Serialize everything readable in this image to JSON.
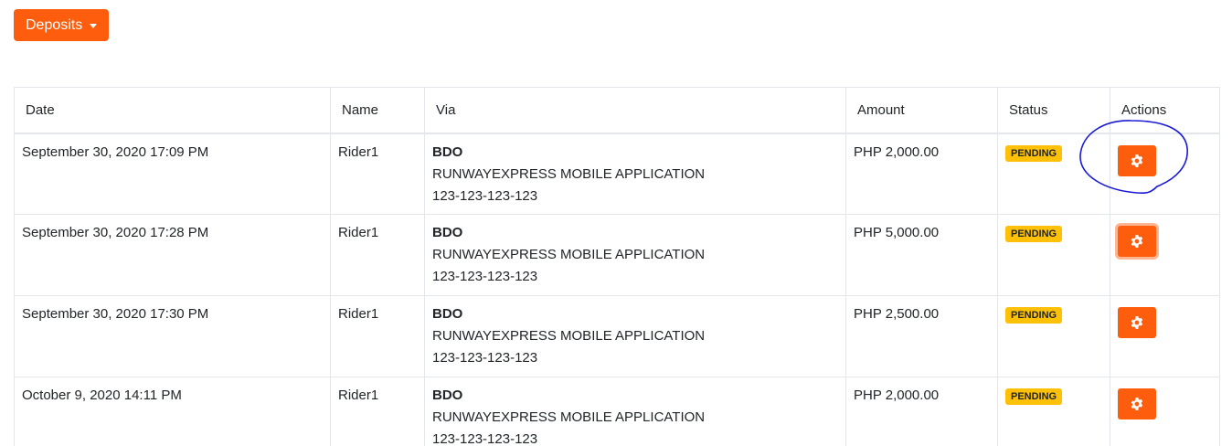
{
  "toolbar": {
    "dropdown_label": "Deposits"
  },
  "table": {
    "headers": {
      "date": "Date",
      "name": "Name",
      "via": "Via",
      "amount": "Amount",
      "status": "Status",
      "actions": "Actions"
    },
    "rows": [
      {
        "date": "September 30, 2020 17:09 PM",
        "name": "Rider1",
        "via_bank": "BDO",
        "via_account": "RUNWAYEXPRESS MOBILE APPLICATION",
        "via_number": "123-123-123-123",
        "amount": "PHP 2,000.00",
        "status": "PENDING"
      },
      {
        "date": "September 30, 2020 17:28 PM",
        "name": "Rider1",
        "via_bank": "BDO",
        "via_account": "RUNWAYEXPRESS MOBILE APPLICATION",
        "via_number": "123-123-123-123",
        "amount": "PHP 5,000.00",
        "status": "PENDING"
      },
      {
        "date": "September 30, 2020 17:30 PM",
        "name": "Rider1",
        "via_bank": "BDO",
        "via_account": "RUNWAYEXPRESS MOBILE APPLICATION",
        "via_number": "123-123-123-123",
        "amount": "PHP 2,500.00",
        "status": "PENDING"
      },
      {
        "date": "October 9, 2020 14:11 PM",
        "name": "Rider1",
        "via_bank": "BDO",
        "via_account": "RUNWAYEXPRESS MOBILE APPLICATION",
        "via_number": "123-123-123-123",
        "amount": "PHP 2,000.00",
        "status": "PENDING"
      }
    ]
  },
  "icons": {
    "action": "gear-icon",
    "dropdown": "caret-down-icon"
  },
  "colors": {
    "accent": "#fd5d0d",
    "pending_badge": "#ffc107",
    "annotation_stroke": "#1a1ad6"
  }
}
